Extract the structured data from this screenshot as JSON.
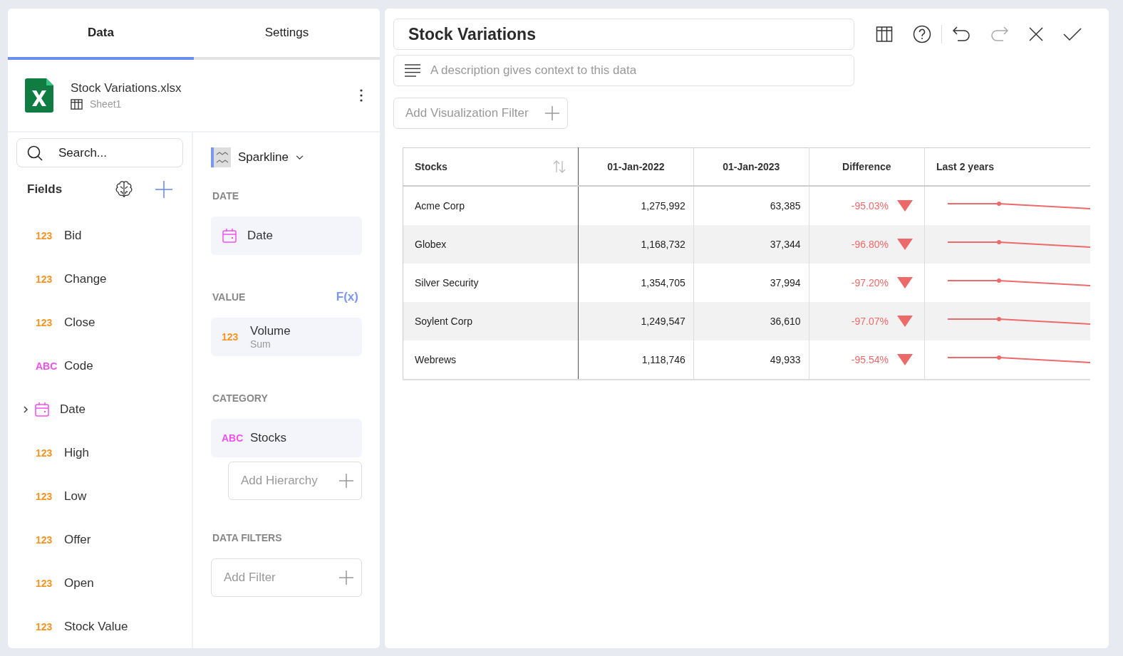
{
  "tabs": [
    {
      "label": "Data",
      "selected": true
    },
    {
      "label": "Settings",
      "selected": false
    }
  ],
  "data_source": {
    "file_name": "Stock Variations.xlsx",
    "sheet": "Sheet1"
  },
  "search": {
    "placeholder": "Search..."
  },
  "fields": {
    "title": "Fields",
    "items": [
      {
        "kind": "number",
        "type_label": "123",
        "name": "Bid"
      },
      {
        "kind": "number",
        "type_label": "123",
        "name": "Change"
      },
      {
        "kind": "number",
        "type_label": "123",
        "name": "Close"
      },
      {
        "kind": "text",
        "type_label": "ABC",
        "name": "Code"
      },
      {
        "kind": "date",
        "name": "Date",
        "expanded": false
      },
      {
        "kind": "number",
        "type_label": "123",
        "name": "High"
      },
      {
        "kind": "number",
        "type_label": "123",
        "name": "Low"
      },
      {
        "kind": "number",
        "type_label": "123",
        "name": "Offer"
      },
      {
        "kind": "number",
        "type_label": "123",
        "name": "Open"
      },
      {
        "kind": "number",
        "type_label": "123",
        "name": "Stock Value"
      }
    ]
  },
  "visualization": {
    "type": "Sparkline"
  },
  "sections": [
    {
      "label": "DATE",
      "items": [
        {
          "kind": "date",
          "name": "Date"
        }
      ]
    },
    {
      "label": "VALUE",
      "action": "F(x)",
      "items": [
        {
          "kind": "number",
          "type_label": "123",
          "name": "Volume",
          "aggregation": "Sum"
        }
      ]
    },
    {
      "label": "CATEGORY",
      "items": [
        {
          "kind": "text",
          "type_label": "ABC",
          "name": "Stocks"
        }
      ],
      "add_button": "Add Hierarchy"
    },
    {
      "label": "DATA FILTERS",
      "add_button": "Add Filter"
    }
  ],
  "title": "Stock Variations",
  "description": {
    "placeholder": "A description gives context to this data"
  },
  "filter_button": "Add Visualization Filter",
  "table": {
    "columns": [
      "Stocks",
      "01-Jan-2022",
      "01-Jan-2023",
      "Difference",
      "Last 2 years"
    ],
    "rows": [
      {
        "cells": [
          "Acme Corp",
          "1,275,992",
          "63,385",
          "-95.03%"
        ]
      },
      {
        "cells": [
          "Globex",
          "1,168,732",
          "37,344",
          "-96.80%"
        ]
      },
      {
        "cells": [
          "Silver Security",
          "1,354,705",
          "37,994",
          "-97.20%"
        ]
      },
      {
        "cells": [
          "Soylent Corp",
          "1,249,547",
          "36,610",
          "-97.07%"
        ]
      },
      {
        "cells": [
          "Webrews",
          "1,118,746",
          "49,933",
          "-95.54%"
        ]
      }
    ]
  }
}
